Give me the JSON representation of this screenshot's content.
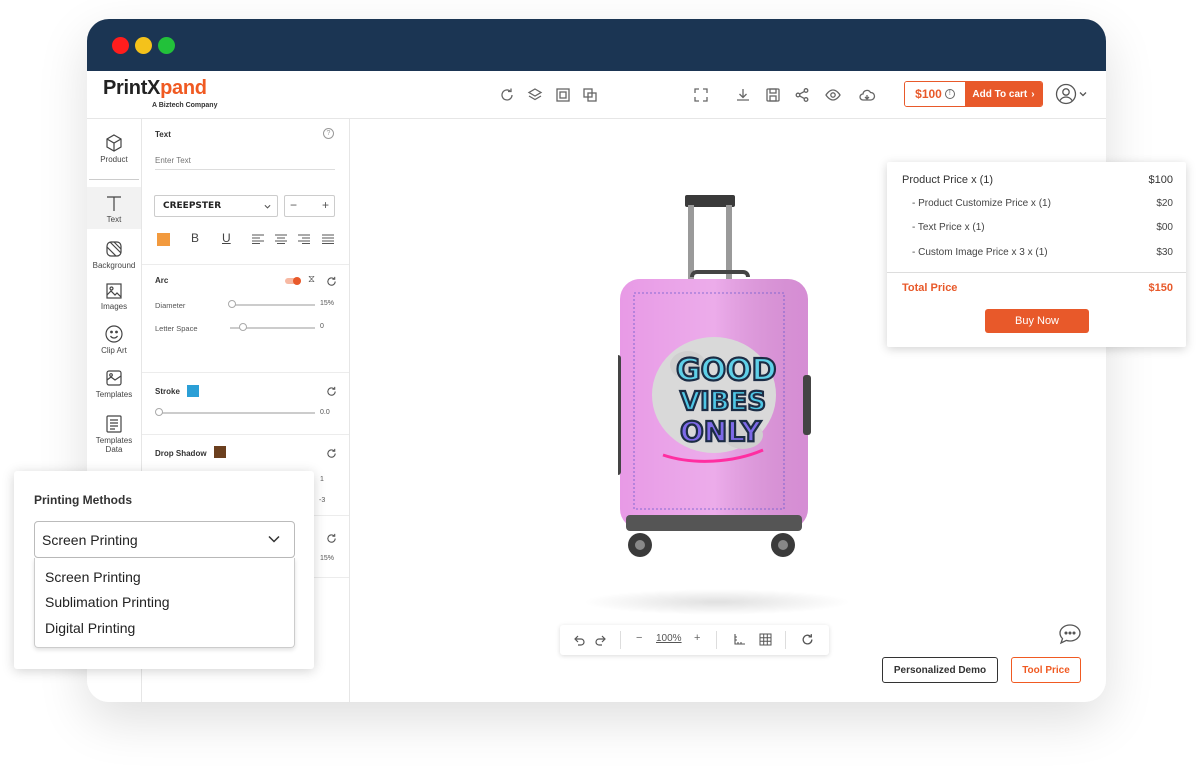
{
  "brand": {
    "name_part1": "PrintX",
    "name_part2": "pand",
    "tagline": "A Biztech Company"
  },
  "header": {
    "price": "$100",
    "add_to_cart": "Add To cart"
  },
  "nav": {
    "items": [
      {
        "label": "Product",
        "icon": "cube-icon"
      },
      {
        "label": "Text",
        "icon": "text-icon"
      },
      {
        "label": "Background",
        "icon": "background-icon"
      },
      {
        "label": "Images",
        "icon": "image-icon"
      },
      {
        "label": "Clip Art",
        "icon": "smiley-icon"
      },
      {
        "label": "Templates",
        "icon": "templates-icon"
      },
      {
        "label": "Templates Data",
        "icon": "templates-data-icon"
      }
    ]
  },
  "text_panel": {
    "title": "Text",
    "input_placeholder": "Enter Text",
    "font": "CREEPSTER",
    "text_color": "#f29a3e",
    "arc": {
      "title": "Arc",
      "diameter_label": "Diameter",
      "diameter_value": "15%",
      "letter_space_label": "Letter Space",
      "letter_space_value": "0"
    },
    "stroke": {
      "title": "Stroke",
      "color": "#2b9fd6",
      "value": "0.0"
    },
    "drop_shadow": {
      "title": "Drop Shadow",
      "color": "#6b3f1e",
      "value1": "1",
      "value2": "-3",
      "value3": "15%"
    }
  },
  "canvas": {
    "zoom": "100%"
  },
  "buttons": {
    "personalized_demo": "Personalized Demo",
    "tool_price": "Tool Price",
    "buy_now": "Buy Now"
  },
  "price_card": {
    "product_price_label": "Product Price  x  (1)",
    "product_price_value": "$100",
    "items": [
      {
        "label": "- Product Customize Price  x  (1)",
        "value": "$20"
      },
      {
        "label": "- Text Price x (1)",
        "value": "$00"
      },
      {
        "label": "- Custom Image Price x 3 x  (1)",
        "value": "$30"
      }
    ],
    "total_label": "Total Price",
    "total_value": "$150"
  },
  "printing_methods": {
    "title": "Printing Methods",
    "selected": "Screen Printing",
    "options": [
      "Screen Printing",
      "Sublimation Printing",
      "Digital Printing"
    ]
  },
  "colors": {
    "accent": "#e8592a",
    "titlebar": "#1b3553",
    "suitcase": "#e89ae6"
  }
}
